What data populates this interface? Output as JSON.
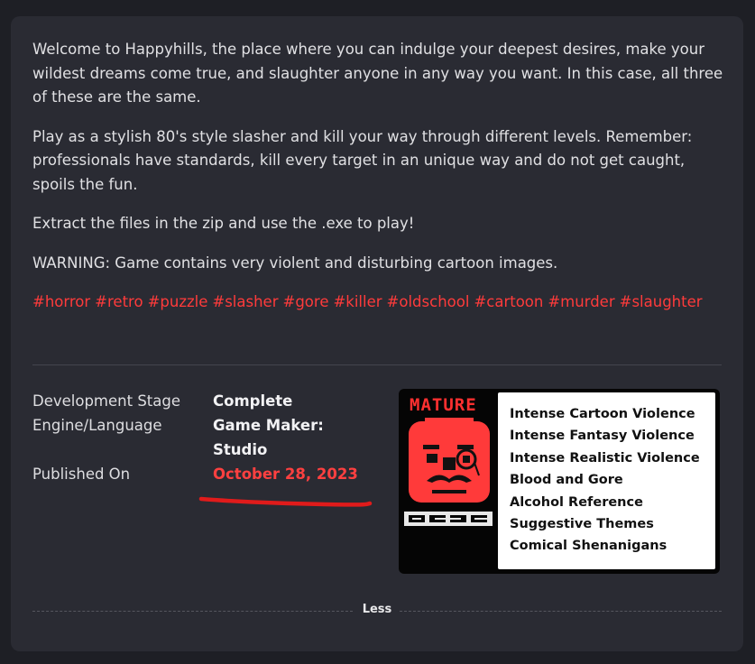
{
  "description": {
    "paragraphs": [
      "Welcome to Happyhills, the place where you can indulge your deepest desires, make your wildest dreams come true, and slaughter anyone in any way you want. In this case, all three of these are the same.",
      "Play as a stylish 80's style slasher and kill your way through different levels. Remember: professionals have standards, kill every target in an unique way and do not get caught, spoils the fun.",
      "Extract the files in the zip and use the .exe to play!",
      "WARNING: Game contains very violent and disturbing cartoon images."
    ],
    "tags": [
      "#horror",
      "#retro",
      "#puzzle",
      "#slasher",
      "#gore",
      "#killer",
      "#oldschool",
      "#cartoon",
      "#murder",
      "#slaughter"
    ]
  },
  "info": {
    "development_stage": {
      "label": "Development Stage",
      "value": "Complete"
    },
    "engine": {
      "label": "Engine/Language",
      "value": "Game Maker: Studio"
    },
    "published": {
      "label": "Published On",
      "value": "October 28, 2023"
    }
  },
  "rating": {
    "level": "MATURE",
    "org": "OGRS",
    "descriptors": [
      "Intense Cartoon Violence",
      "Intense Fantasy Violence",
      "Intense Realistic Violence",
      "Blood and Gore",
      "Alcohol Reference",
      "Suggestive Themes",
      "Comical Shenanigans"
    ]
  },
  "toggle": {
    "less_label": "Less"
  },
  "colors": {
    "tag": "#ff3b3b",
    "date": "#ff4040",
    "underline": "#e01b1b",
    "card": "#2a2b33"
  }
}
